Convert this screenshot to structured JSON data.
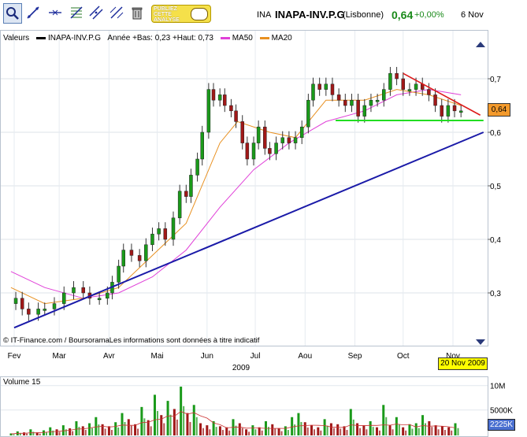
{
  "toolbar": {
    "tools": [
      "zoom-icon",
      "draw-line-icon",
      "horizontal-line-icon",
      "fibonacci-icon",
      "channel-icon",
      "parallel-line-icon",
      "trash-icon"
    ],
    "ad_line1": "PUBLIEZ",
    "ad_line2": "CETTE",
    "ad_line3": "ANALYSE"
  },
  "header": {
    "ticker": "INA",
    "name": "INAPA-INV.P.G",
    "market": "(Lisbonne)",
    "price": "0,64",
    "change": "+0,00%",
    "date": "6 Nov"
  },
  "legend": {
    "title": "Valeurs",
    "series_name": "INAPA-INV.P.G",
    "range": "Année +Bas: 0,23 +Haut: 0,73",
    "ma50": "MA50",
    "ma20": "MA20"
  },
  "credit": "© IT-Finance.com / BoursoramaLes informations sont données à titre indicatif",
  "price_box": "0,64",
  "date_box": "20 Nov 2009",
  "year_label": "2009",
  "colors": {
    "up": "#1a9a1a",
    "down": "#a01818",
    "ma50": "#e040d8",
    "ma20": "#e89020",
    "support": "#22dd22",
    "trend": "#1a1aa8",
    "resistance": "#dd1a1a"
  },
  "chart_data": [
    {
      "type": "line",
      "title": "INAPA-INV.P.G",
      "x_ticks": [
        "Fev",
        "Mar",
        "Avr",
        "Mai",
        "Jun",
        "Jul",
        "Aou",
        "Sep",
        "Oct",
        "Nov"
      ],
      "y_ticks": [
        "0,7",
        "0,6",
        "0,5",
        "0,4",
        "0,3"
      ],
      "ylim": [
        0.22,
        0.76
      ],
      "grid": true,
      "series": [
        {
          "name": "INAPA-INV.P.G",
          "points": [
            [
              "2009-02-02",
              0.29
            ],
            [
              "2009-02-06",
              0.27
            ],
            [
              "2009-02-10",
              0.26
            ],
            [
              "2009-02-16",
              0.27
            ],
            [
              "2009-02-20",
              0.27
            ],
            [
              "2009-02-26",
              0.28
            ],
            [
              "2009-03-04",
              0.3
            ],
            [
              "2009-03-10",
              0.31
            ],
            [
              "2009-03-16",
              0.3
            ],
            [
              "2009-03-20",
              0.29
            ],
            [
              "2009-03-26",
              0.29
            ],
            [
              "2009-03-31",
              0.3
            ],
            [
              "2009-04-03",
              0.32
            ],
            [
              "2009-04-07",
              0.35
            ],
            [
              "2009-04-10",
              0.38
            ],
            [
              "2009-04-15",
              0.37
            ],
            [
              "2009-04-20",
              0.36
            ],
            [
              "2009-04-24",
              0.39
            ],
            [
              "2009-04-28",
              0.41
            ],
            [
              "2009-05-02",
              0.42
            ],
            [
              "2009-05-06",
              0.4
            ],
            [
              "2009-05-11",
              0.44
            ],
            [
              "2009-05-15",
              0.49
            ],
            [
              "2009-05-19",
              0.48
            ],
            [
              "2009-05-22",
              0.52
            ],
            [
              "2009-05-26",
              0.55
            ],
            [
              "2009-05-29",
              0.6
            ],
            [
              "2009-06-02",
              0.68
            ],
            [
              "2009-06-05",
              0.66
            ],
            [
              "2009-06-09",
              0.67
            ],
            [
              "2009-06-12",
              0.65
            ],
            [
              "2009-06-16",
              0.64
            ],
            [
              "2009-06-19",
              0.62
            ],
            [
              "2009-06-23",
              0.58
            ],
            [
              "2009-06-26",
              0.55
            ],
            [
              "2009-06-30",
              0.58
            ],
            [
              "2009-07-03",
              0.61
            ],
            [
              "2009-07-07",
              0.57
            ],
            [
              "2009-07-10",
              0.56
            ],
            [
              "2009-07-14",
              0.58
            ],
            [
              "2009-07-18",
              0.59
            ],
            [
              "2009-07-22",
              0.58
            ],
            [
              "2009-07-26",
              0.59
            ],
            [
              "2009-07-30",
              0.61
            ],
            [
              "2009-08-03",
              0.66
            ],
            [
              "2009-08-06",
              0.69
            ],
            [
              "2009-08-10",
              0.68
            ],
            [
              "2009-08-14",
              0.69
            ],
            [
              "2009-08-18",
              0.67
            ],
            [
              "2009-08-22",
              0.66
            ],
            [
              "2009-08-26",
              0.65
            ],
            [
              "2009-08-30",
              0.66
            ],
            [
              "2009-09-03",
              0.63
            ],
            [
              "2009-09-07",
              0.65
            ],
            [
              "2009-09-11",
              0.66
            ],
            [
              "2009-09-15",
              0.66
            ],
            [
              "2009-09-19",
              0.68
            ],
            [
              "2009-09-23",
              0.71
            ],
            [
              "2009-09-27",
              0.7
            ],
            [
              "2009-10-01",
              0.68
            ],
            [
              "2009-10-05",
              0.68
            ],
            [
              "2009-10-09",
              0.69
            ],
            [
              "2009-10-13",
              0.68
            ],
            [
              "2009-10-17",
              0.67
            ],
            [
              "2009-10-21",
              0.65
            ],
            [
              "2009-10-25",
              0.63
            ],
            [
              "2009-10-29",
              0.65
            ],
            [
              "2009-11-02",
              0.64
            ],
            [
              "2009-11-06",
              0.64
            ]
          ]
        },
        {
          "name": "MA50",
          "points": [
            [
              "2009-01-30",
              0.34
            ],
            [
              "2009-02-20",
              0.31
            ],
            [
              "2009-03-16",
              0.29
            ],
            [
              "2009-04-07",
              0.3
            ],
            [
              "2009-04-28",
              0.33
            ],
            [
              "2009-05-19",
              0.38
            ],
            [
              "2009-06-09",
              0.46
            ],
            [
              "2009-06-30",
              0.53
            ],
            [
              "2009-07-22",
              0.58
            ],
            [
              "2009-08-14",
              0.62
            ],
            [
              "2009-09-07",
              0.64
            ],
            [
              "2009-09-27",
              0.67
            ],
            [
              "2009-10-17",
              0.68
            ],
            [
              "2009-11-06",
              0.67
            ]
          ]
        },
        {
          "name": "MA20",
          "points": [
            [
              "2009-01-30",
              0.31
            ],
            [
              "2009-02-20",
              0.28
            ],
            [
              "2009-03-16",
              0.29
            ],
            [
              "2009-04-07",
              0.31
            ],
            [
              "2009-04-28",
              0.37
            ],
            [
              "2009-05-19",
              0.43
            ],
            [
              "2009-06-09",
              0.58
            ],
            [
              "2009-06-20",
              0.62
            ],
            [
              "2009-07-10",
              0.6
            ],
            [
              "2009-07-26",
              0.59
            ],
            [
              "2009-08-14",
              0.66
            ],
            [
              "2009-09-07",
              0.66
            ],
            [
              "2009-09-27",
              0.68
            ],
            [
              "2009-10-17",
              0.67
            ],
            [
              "2009-11-06",
              0.65
            ]
          ]
        }
      ],
      "trendlines": [
        {
          "kind": "support-trend",
          "from": [
            "2009-02-01",
            0.235
          ],
          "to": [
            "2009-11-20",
            0.6
          ]
        },
        {
          "kind": "horizontal-support",
          "from": [
            "2009-08-20",
            0.622
          ],
          "to": [
            "2009-11-20",
            0.622
          ]
        },
        {
          "kind": "descending-resistance",
          "from": [
            "2009-10-01",
            0.71
          ],
          "to": [
            "2009-11-18",
            0.632
          ]
        }
      ]
    },
    {
      "type": "bar",
      "title": "Volume 15",
      "y_ticks": [
        "10M",
        "5000K"
      ],
      "last_value": "2225K",
      "values": [
        2,
        4,
        3,
        6,
        3,
        5,
        8,
        6,
        10,
        7,
        14,
        9,
        12,
        18,
        11,
        9,
        13,
        22,
        16,
        11,
        28,
        15,
        40,
        20,
        34,
        26,
        48,
        22,
        30,
        12,
        10,
        14,
        9,
        8,
        16,
        12,
        6,
        10,
        8,
        14,
        11,
        7,
        9,
        18,
        22,
        13,
        10,
        8,
        16,
        12,
        11,
        9,
        26,
        12,
        10,
        14,
        8,
        30,
        10,
        18,
        8,
        11,
        12,
        20,
        14,
        10,
        9,
        8,
        12
      ]
    }
  ]
}
